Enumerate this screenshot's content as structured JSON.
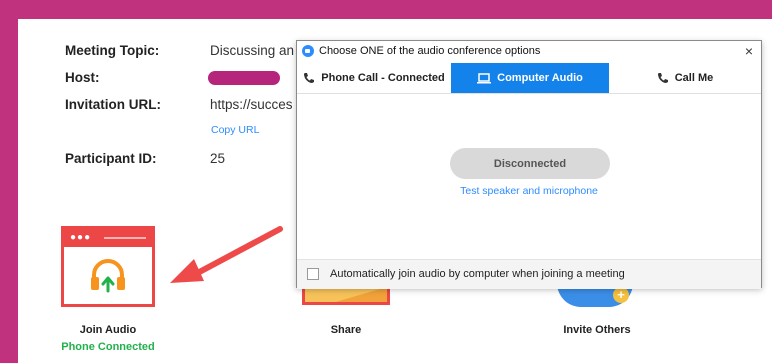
{
  "meeting": {
    "topic_label": "Meeting Topic:",
    "topic_value": "Discussing an",
    "host_label": "Host:",
    "invitation_label": "Invitation URL:",
    "invitation_value": "https://succes",
    "copy_url": "Copy URL",
    "participant_label": "Participant ID:",
    "participant_value": "25"
  },
  "actions": {
    "join_audio": "Join Audio",
    "join_audio_status": "Phone Connected",
    "share": "Share",
    "invite": "Invite Others"
  },
  "dialog": {
    "title": "Choose ONE of the audio conference options",
    "close": "×",
    "tabs": [
      {
        "label": "Phone Call - Connected",
        "icon": "phone-icon",
        "active": false
      },
      {
        "label": "Computer Audio",
        "icon": "laptop-icon",
        "active": true
      },
      {
        "label": "Call Me",
        "icon": "phone-icon",
        "active": false
      }
    ],
    "status_button": "Disconnected",
    "test_link": "Test speaker and microphone",
    "auto_join_label": "Automatically join audio by computer when joining a meeting",
    "auto_join_checked": false
  },
  "colors": {
    "background": "#c0317e",
    "accent": "#1482eb",
    "alert": "#ed4646",
    "success": "#22b24c"
  }
}
